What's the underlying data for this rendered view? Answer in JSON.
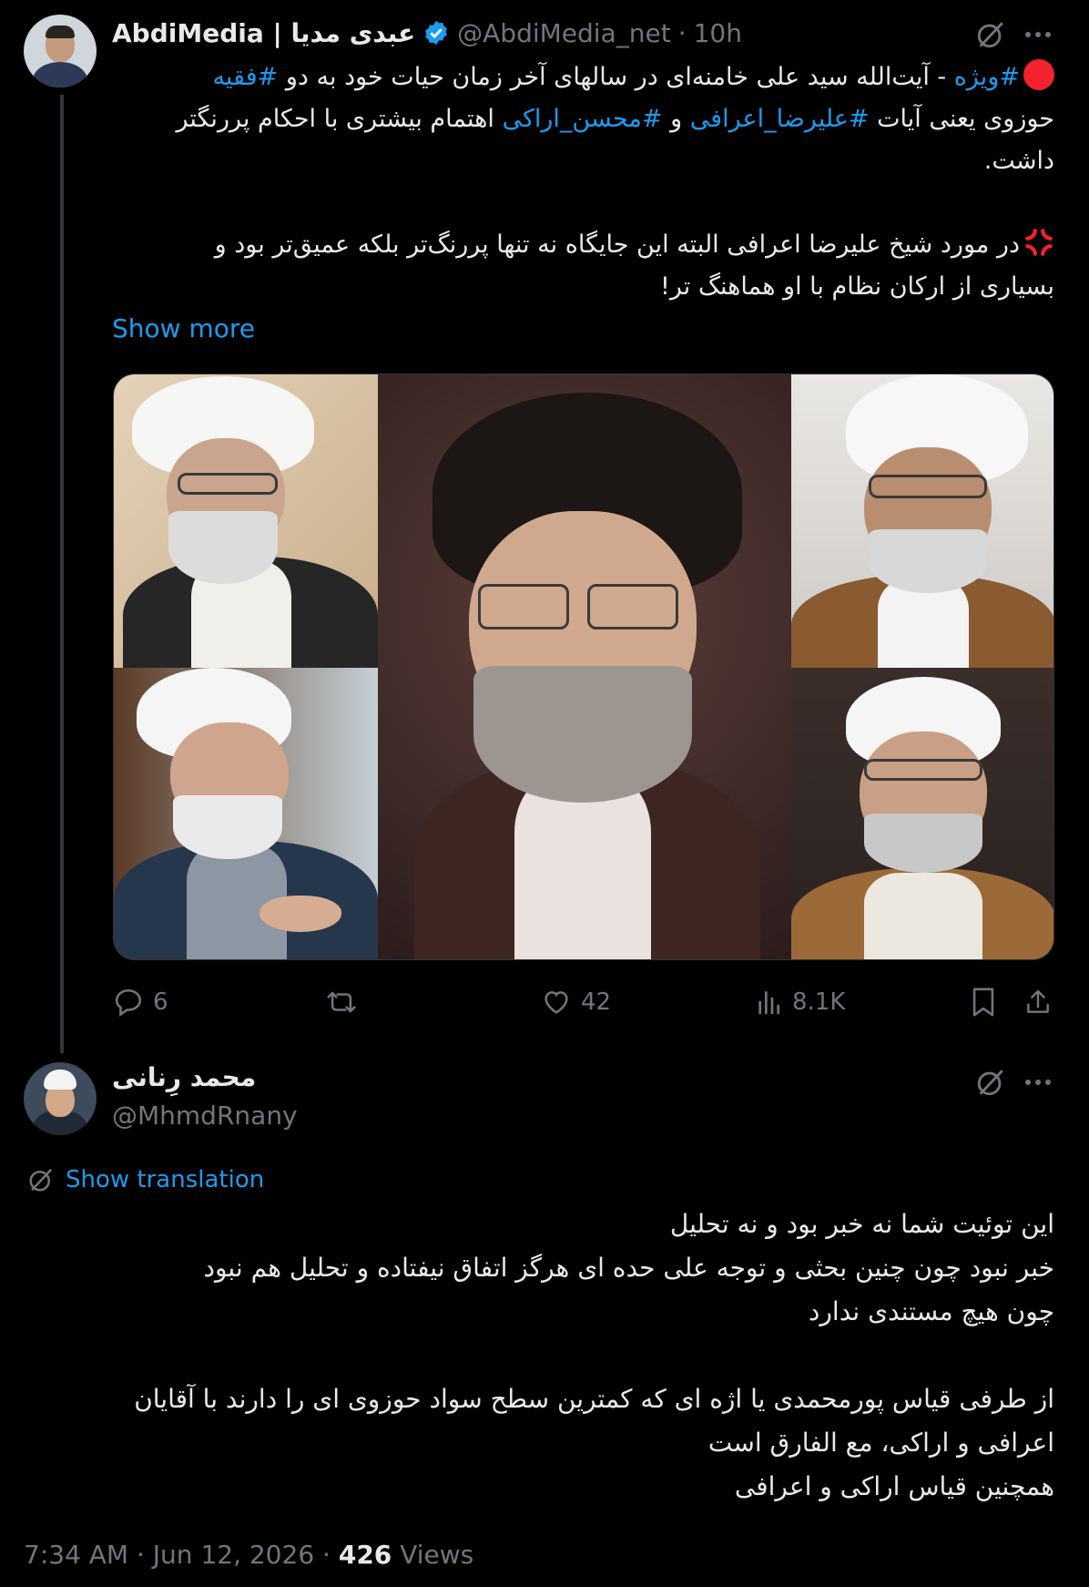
{
  "colors": {
    "background": "#000000",
    "text": "#e7e9ea",
    "muted": "#71767b",
    "accent": "#1d9bf0",
    "red": "#f4212e"
  },
  "tweet": {
    "author_name": "AbdiMedia | عبدی مدیا",
    "handle": "@AbdiMedia_net",
    "separator": "·",
    "time": "10h",
    "icons": {
      "verified": "verified-badge-icon",
      "grok": "grok-icon",
      "more": "more-icon"
    },
    "lines": [
      {
        "hashtag": "#ویژه",
        "text": " - آیت‌الله سید علی خامنه‌ای در سالهای آخر زمان حیات خود به دو ",
        "hashtag2": "#فقیه"
      },
      {
        "pre": "حوزوی یعنی آیات ",
        "hashtag": "#علیرضا_اعرافی",
        "mid": " و ",
        "hashtag2": "#محسن_اراکی",
        "post": " اهتمام بیشتری با احکام پررنگتر"
      },
      {
        "text": "داشت."
      },
      {
        "text": "در مورد شیخ علیرضا اعرافی البته این جایگاه نه تنها پررنگ‌تر بلکه عمیق‌تر بود و"
      },
      {
        "text": "بسیاری از ارکان نظام با او هماهنگ تر!"
      }
    ],
    "show_more": "Show more",
    "media_label": "Collage of five clerics",
    "stats": {
      "replies": "6",
      "retweets": "",
      "likes": "42",
      "views": "8.1K"
    }
  },
  "reply": {
    "author_name": "محمد رِنانی",
    "handle": "@MhmdRnany",
    "show_translation": "Show translation",
    "lines": [
      "این توئیت شما نه خبر بود و نه تحلیل",
      "خبر نبود چون چنین بحثی و توجه علی حده ای هرگز اتفاق نیفتاده و تحلیل هم نبود",
      "چون هیچ مستندی ندارد",
      "از طرفی قیاس پورمحمدی یا اژه ای که کمترین سطح سواد حوزوی ای را دارند با آقایان",
      "اعرافی و اراکی، مع الفارق است",
      "همچنین قیاس اراکی و اعرافی"
    ],
    "timestamp": "7:34 AM · Jun 12, 2026 · ",
    "views_count": "426",
    "views_label": " Views"
  }
}
